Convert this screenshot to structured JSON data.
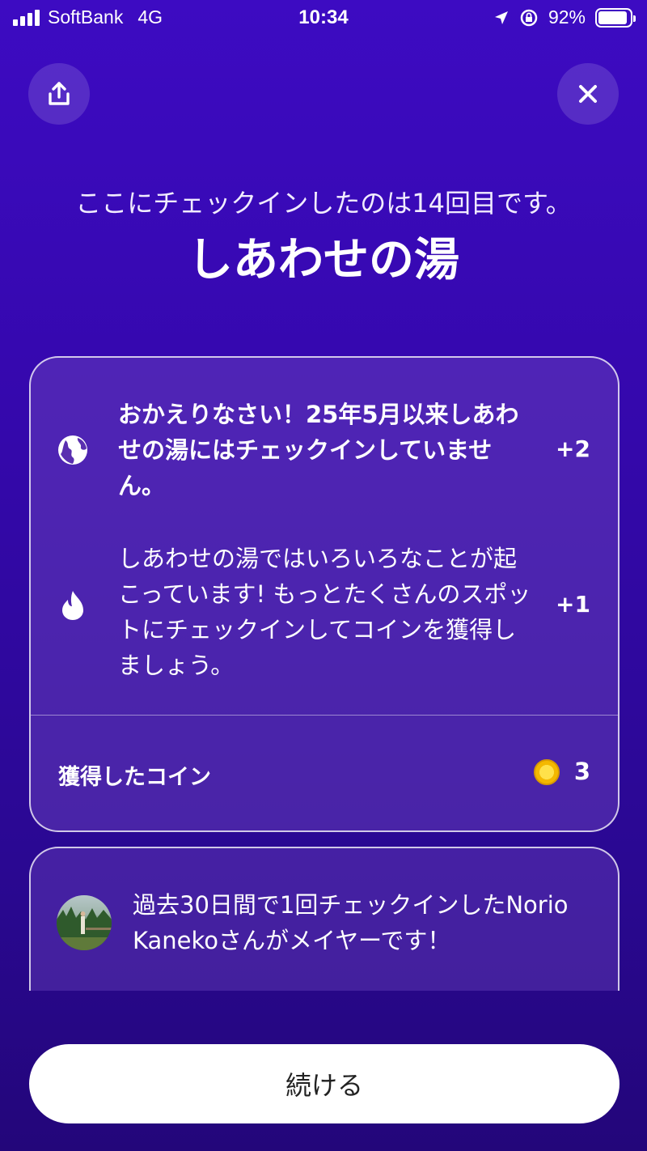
{
  "status_bar": {
    "carrier": "SoftBank",
    "network": "4G",
    "time": "10:34",
    "battery": "92%",
    "icons": [
      "signal-icon",
      "location-icon",
      "rotation-lock-icon",
      "battery-icon"
    ]
  },
  "header": {
    "share_icon": "share-icon",
    "close_icon": "close-icon",
    "subtitle": "ここにチェックインしたのは14回目です。",
    "title": "しあわせの湯"
  },
  "rewards": {
    "items": [
      {
        "icon": "globe-icon",
        "text": "おかえりなさい！25年5月以来しあわせの湯にはチェックインしていません。",
        "points": "+2"
      },
      {
        "icon": "flame-icon",
        "text": "しあわせの湯ではいろいろなことが起こっています! もっとたくさんのスポットにチェックインしてコインを獲得しましょう。",
        "points": "+1"
      }
    ],
    "coins_label": "獲得したコイン",
    "coin_icon": "coin-icon",
    "coins_value": "3"
  },
  "mayor": {
    "text": "過去30日間で1回チェックインしたNorio Kanekoさんがメイヤーです！"
  },
  "footer": {
    "continue_label": "続ける"
  },
  "colors": {
    "background_top": "#3d0bc2",
    "background_bottom": "#23067a",
    "coin": "#f4b800"
  }
}
